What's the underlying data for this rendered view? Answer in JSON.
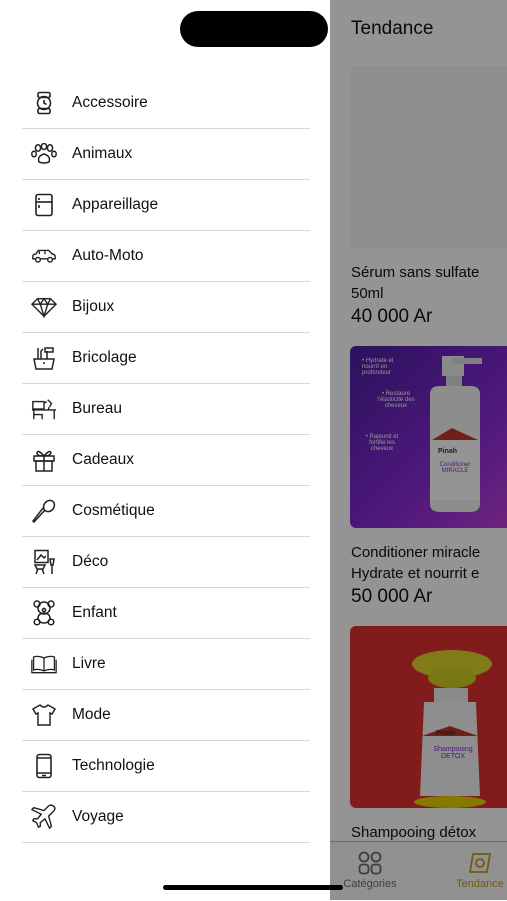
{
  "drawer": {
    "items": [
      {
        "label": "Accessoire",
        "icon": "watch-icon"
      },
      {
        "label": "Animaux",
        "icon": "paw-icon"
      },
      {
        "label": "Appareillage",
        "icon": "fridge-icon"
      },
      {
        "label": "Auto-Moto",
        "icon": "car-icon"
      },
      {
        "label": "Bijoux",
        "icon": "diamond-icon"
      },
      {
        "label": "Bricolage",
        "icon": "tools-icon"
      },
      {
        "label": "Bureau",
        "icon": "desk-icon"
      },
      {
        "label": "Cadeaux",
        "icon": "gift-icon"
      },
      {
        "label": "Cosmétique",
        "icon": "brush-icon"
      },
      {
        "label": "Déco",
        "icon": "decor-icon"
      },
      {
        "label": "Enfant",
        "icon": "teddy-bear-icon"
      },
      {
        "label": "Livre",
        "icon": "book-icon"
      },
      {
        "label": "Mode",
        "icon": "tshirt-icon"
      },
      {
        "label": "Technologie",
        "icon": "phone-icon"
      },
      {
        "label": "Voyage",
        "icon": "plane-icon"
      }
    ]
  },
  "background": {
    "title": "Tendance",
    "products": [
      {
        "name": "Sérum sans sulfate",
        "name2": "50ml",
        "price": "40 000 Ar"
      },
      {
        "name": "Conditioner miracle",
        "name2": "Hydrate et nourrit e",
        "price": "50 000 Ar"
      },
      {
        "name": "Shampooing détox",
        "name2": "",
        "price": ""
      }
    ],
    "card2_texts": {
      "t1": "• Hydrate et nourrit en profondeur",
      "t2": "• Restaure l'élasticité des cheveux",
      "t3": "• Rajeunit et fortifie les cheveux",
      "brand": "Pinah",
      "product": "Conditioner MIRACLE"
    },
    "card3_texts": {
      "brand": "Pinah",
      "product": "Shampooing DETOX"
    },
    "tabs": [
      {
        "label": "Catégories",
        "color": "#6b6b6b"
      },
      {
        "label": "Tendance",
        "color": "#c99a1a"
      }
    ]
  }
}
